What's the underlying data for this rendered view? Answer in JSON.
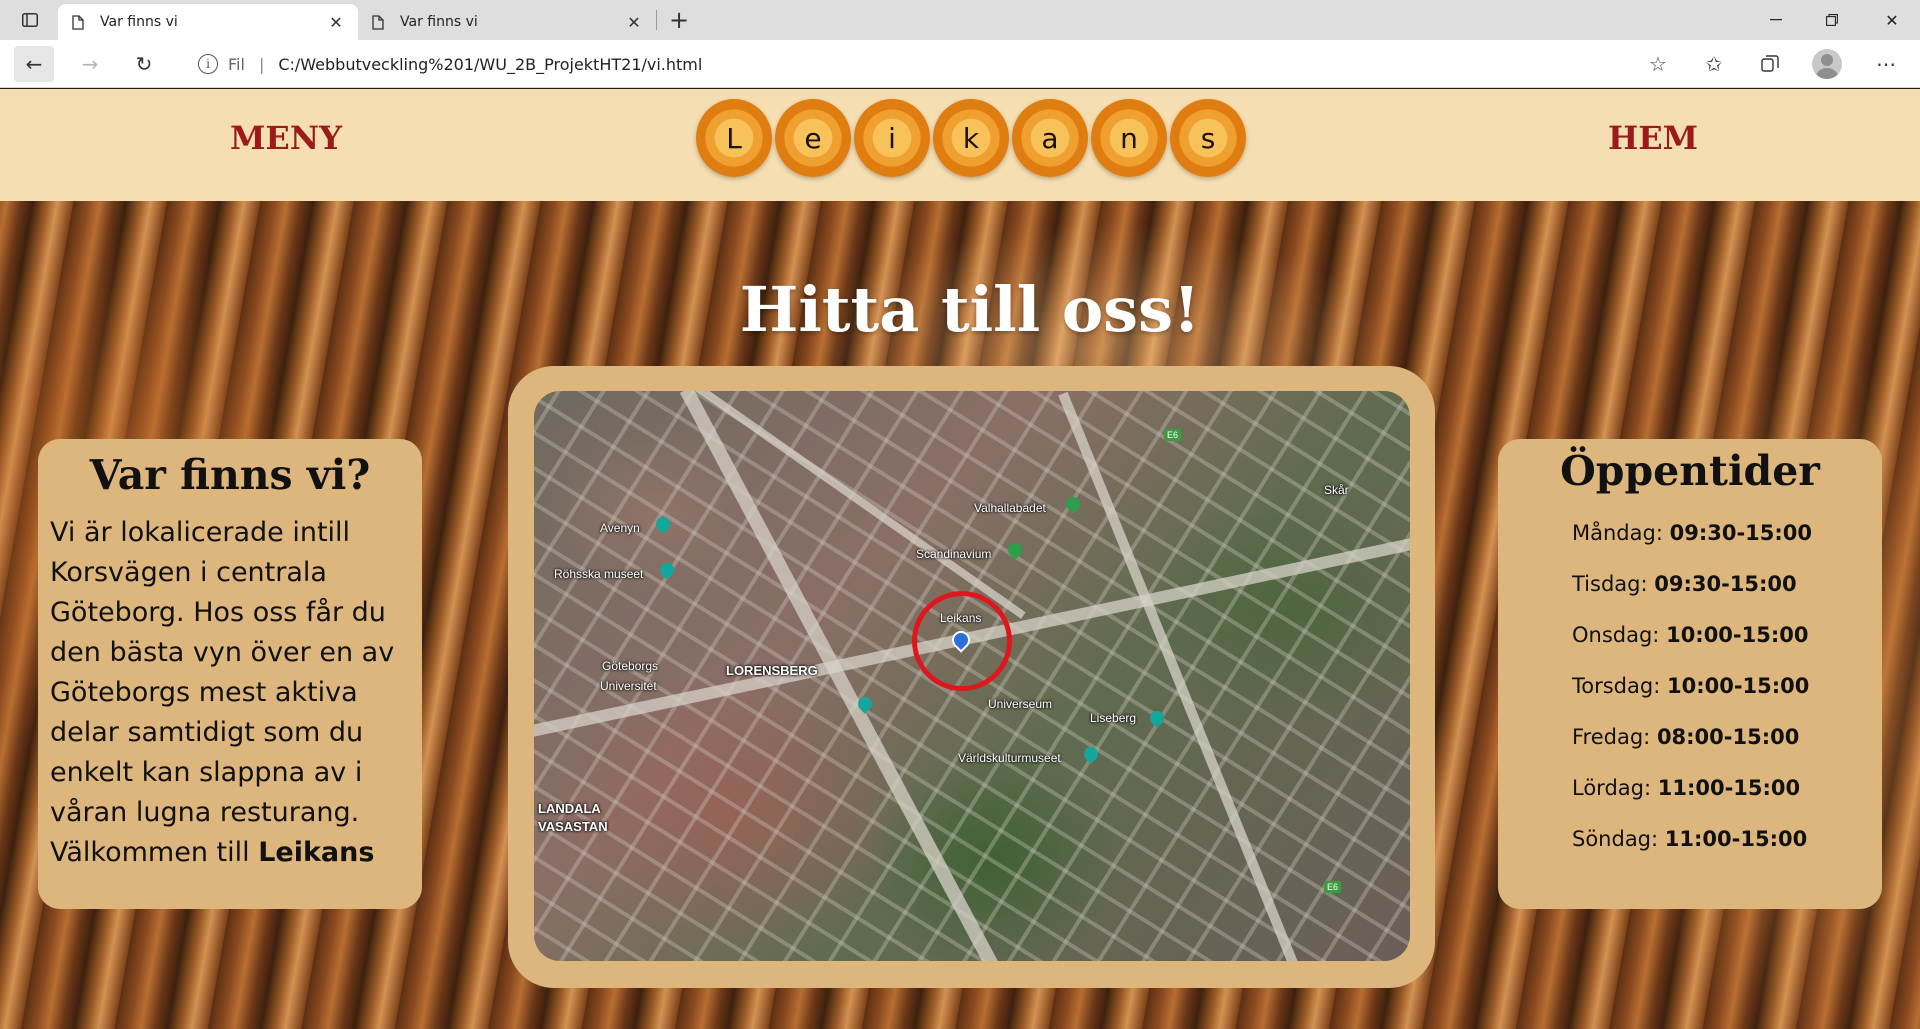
{
  "browser": {
    "tabs": [
      {
        "title": "Var finns vi",
        "active": true
      },
      {
        "title": "Var finns vi",
        "active": false
      }
    ],
    "address": {
      "protocol_label": "Fil",
      "url": "C:/Webbutveckling%201/WU_2B_ProjektHT21/vi.html"
    }
  },
  "header": {
    "nav_left": "MENY",
    "nav_right": "HEM",
    "logo_letters": [
      "L",
      "e",
      "i",
      "k",
      "a",
      "n",
      "s"
    ]
  },
  "main": {
    "title": "Hitta till oss!",
    "location_card": {
      "heading": "Var finns vi?",
      "text": "Vi är lokalicerade intill Korsvägen i centrala Göteborg. Hos oss får du den bästa vyn över en av Göteborgs mest aktiva delar samtidigt som du enkelt kan slappna av i våran lugna resturang. Välkommen till ",
      "text_bold": "Leikans"
    },
    "hours_card": {
      "heading": "Öppentider",
      "rows": [
        {
          "day": "Måndag:",
          "time": "09:30-15:00"
        },
        {
          "day": "Tisdag:",
          "time": "09:30-15:00"
        },
        {
          "day": "Onsdag:",
          "time": "10:00-15:00"
        },
        {
          "day": "Torsdag:",
          "time": "10:00-15:00"
        },
        {
          "day": "Fredag:",
          "time": "08:00-15:00"
        },
        {
          "day": "Lördag:",
          "time": "11:00-15:00"
        },
        {
          "day": "Söndag:",
          "time": "11:00-15:00"
        }
      ]
    },
    "map": {
      "labels": {
        "avenyn": "Avenyn",
        "rohsska": "Röhsska museet",
        "valhallabadet": "Valhallabadet",
        "scandinavium": "Scandinavium",
        "skar": "Skår",
        "leikans": "Leikans",
        "goteborgs": "Göteborgs",
        "universitet": "Universitet",
        "lorensberg": "LORENSBERG",
        "universeum": "Universeum",
        "liseberg": "Liseberg",
        "varldskultur": "Världskulturmuseet",
        "landala": "LANDALA",
        "vasastan": "VASASTAN",
        "e6_top": "E6",
        "e6_bottom": "E6"
      },
      "highlight_color": "#e0161e"
    }
  }
}
